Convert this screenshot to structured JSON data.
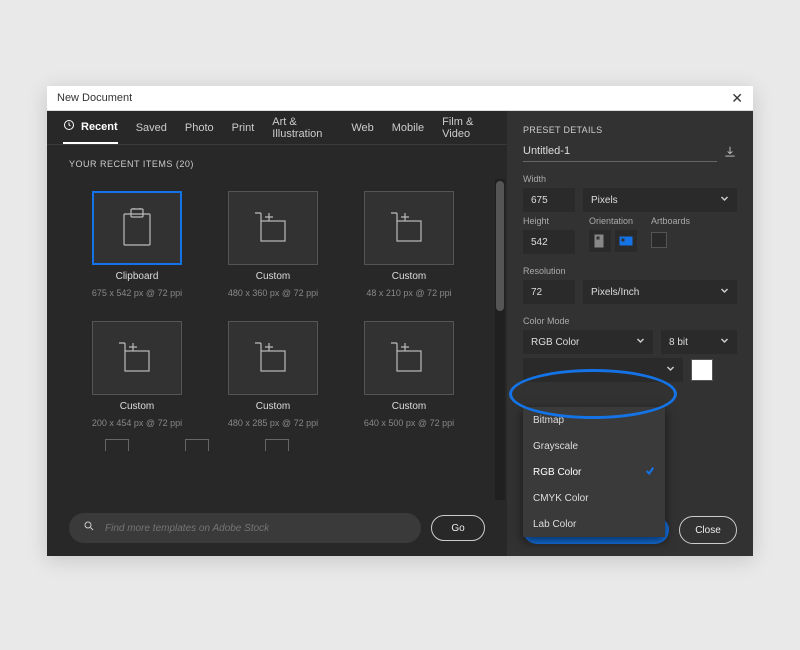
{
  "window": {
    "title": "New Document"
  },
  "tabs": [
    {
      "label": "Recent",
      "active": true
    },
    {
      "label": "Saved"
    },
    {
      "label": "Photo"
    },
    {
      "label": "Print"
    },
    {
      "label": "Art & Illustration"
    },
    {
      "label": "Web"
    },
    {
      "label": "Mobile"
    },
    {
      "label": "Film & Video"
    }
  ],
  "section_label": "YOUR RECENT ITEMS  (20)",
  "presets": [
    {
      "title": "Clipboard",
      "sub": "675 x 542 px @ 72 ppi",
      "icon": "clipboard",
      "selected": true
    },
    {
      "title": "Custom",
      "sub": "480 x 360 px @ 72 ppi",
      "icon": "newdoc"
    },
    {
      "title": "Custom",
      "sub": "48 x 210 px @ 72 ppi",
      "icon": "newdoc"
    },
    {
      "title": "Custom",
      "sub": "200 x 454 px @ 72 ppi",
      "icon": "newdoc"
    },
    {
      "title": "Custom",
      "sub": "480 x 285 px @ 72 ppi",
      "icon": "newdoc"
    },
    {
      "title": "Custom",
      "sub": "640 x 500 px @ 72 ppi",
      "icon": "newdoc"
    }
  ],
  "search": {
    "placeholder": "Find more templates on Adobe Stock",
    "go_label": "Go"
  },
  "details": {
    "header": "PRESET DETAILS",
    "name": "Untitled-1",
    "width_label": "Width",
    "width_value": "675",
    "width_unit": "Pixels",
    "height_label": "Height",
    "height_value": "542",
    "orientation_label": "Orientation",
    "artboards_label": "Artboards",
    "orientation": "landscape",
    "artboards_checked": false,
    "resolution_label": "Resolution",
    "resolution_value": "72",
    "resolution_unit": "Pixels/Inch",
    "colormode_label": "Color Mode",
    "colormode_value": "RGB Color",
    "depth_value": "8 bit",
    "colormode_options": [
      {
        "label": "Bitmap"
      },
      {
        "label": "Grayscale"
      },
      {
        "label": "RGB Color",
        "selected": true
      },
      {
        "label": "CMYK Color"
      },
      {
        "label": "Lab Color"
      }
    ],
    "bgcolor_hex": "#ffffff"
  },
  "buttons": {
    "close": "Close"
  }
}
